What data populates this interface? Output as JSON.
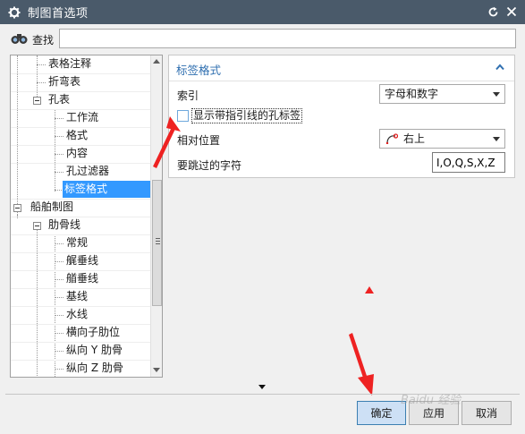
{
  "window": {
    "title": "制图首选项"
  },
  "search": {
    "label": "查找",
    "value": ""
  },
  "tree": {
    "items": [
      {
        "label": "表格注释"
      },
      {
        "label": "折弯表"
      },
      {
        "label": "孔表"
      },
      {
        "label": "工作流"
      },
      {
        "label": "格式"
      },
      {
        "label": "内容"
      },
      {
        "label": "孔过滤器"
      },
      {
        "label": "标签格式"
      },
      {
        "label": "船舶制图"
      },
      {
        "label": "肋骨线"
      },
      {
        "label": "常规"
      },
      {
        "label": "艉垂线"
      },
      {
        "label": "艏垂线"
      },
      {
        "label": "基线"
      },
      {
        "label": "水线"
      },
      {
        "label": "横向子肋位"
      },
      {
        "label": "纵向 Y 肋骨"
      },
      {
        "label": "纵向 Z 肋骨"
      }
    ]
  },
  "panel": {
    "title": "标签格式",
    "index_label": "索引",
    "index_value": "字母和数字",
    "checkbox_label": "显示带指引线的孔标签",
    "position_label": "相对位置",
    "position_value": "右上",
    "skip_label": "要跳过的字符",
    "skip_value": "I,O,Q,S,X,Z"
  },
  "buttons": {
    "ok": "确定",
    "apply": "应用",
    "cancel": "取消"
  },
  "watermark": "Baidu 经验",
  "colors": {
    "titlebar": "#4a5a6a",
    "accent": "#2f6fb0",
    "selection": "#3399ff",
    "annotation_red": "#ee2222"
  }
}
